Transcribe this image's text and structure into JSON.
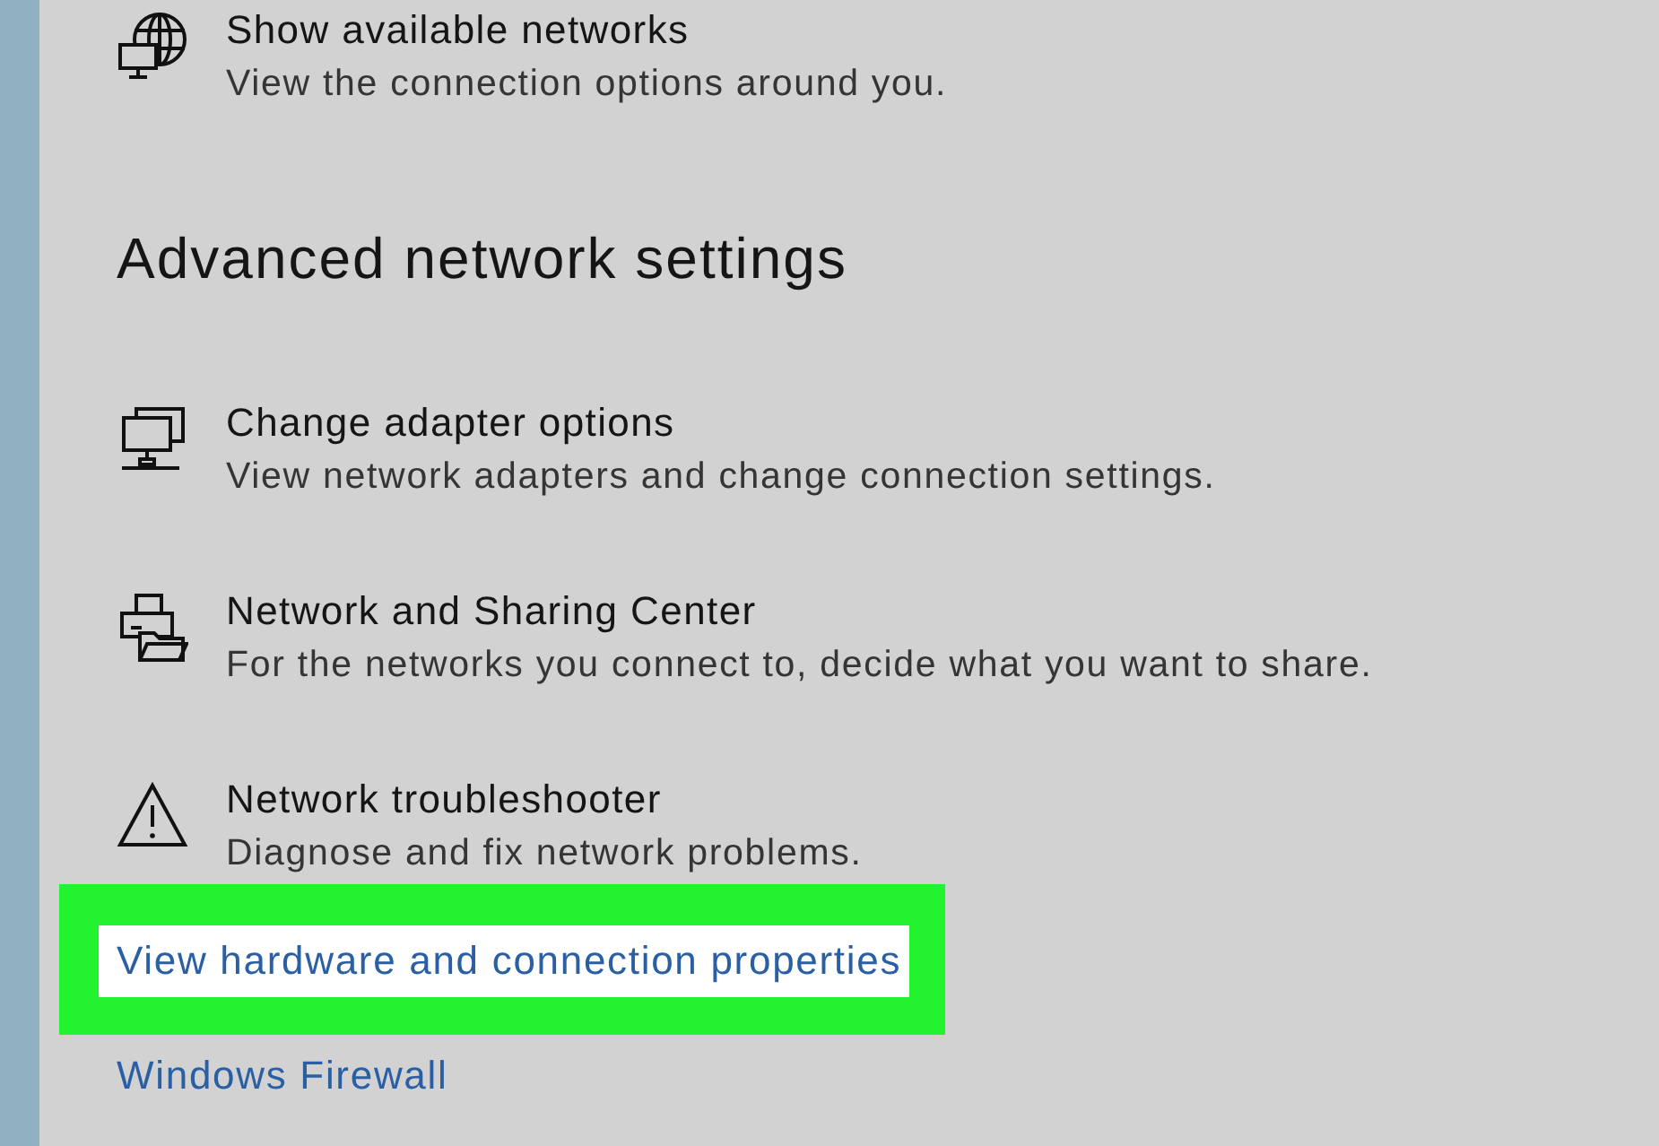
{
  "network_status": {
    "items": [
      {
        "kind": "available-networks",
        "title": "Show available networks",
        "description": "View the connection options around you."
      }
    ]
  },
  "advanced": {
    "heading": "Advanced network settings",
    "items": [
      {
        "kind": "adapter",
        "title": "Change adapter options",
        "description": "View network adapters and change connection settings."
      },
      {
        "kind": "sharing",
        "title": "Network and Sharing Center",
        "description": "For the networks you connect to, decide what you want to share."
      },
      {
        "kind": "troubleshooter",
        "title": "Network troubleshooter",
        "description": "Diagnose and fix network problems."
      }
    ],
    "links": [
      {
        "label": "View hardware and connection properties",
        "highlighted": true
      },
      {
        "label": "Windows Firewall",
        "highlighted": false
      }
    ]
  }
}
